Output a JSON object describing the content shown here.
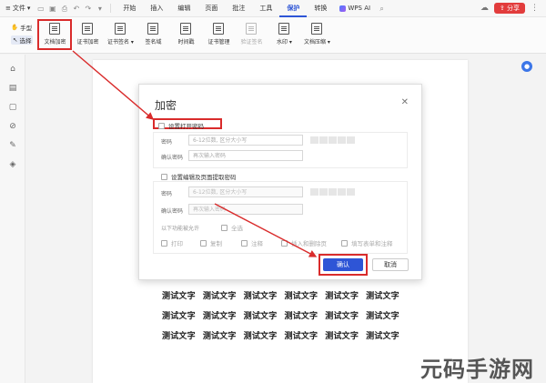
{
  "menubar": {
    "file_label": "文件",
    "tabs": [
      {
        "label": "开始"
      },
      {
        "label": "插入"
      },
      {
        "label": "编辑"
      },
      {
        "label": "页面"
      },
      {
        "label": "批注"
      },
      {
        "label": "工具"
      },
      {
        "label": "保护",
        "active": true
      },
      {
        "label": "转换"
      }
    ],
    "ai_label": "WPS AI",
    "share_label": "分享"
  },
  "ribbon": {
    "mode_items": [
      {
        "label": "手型",
        "icon": "hand-icon"
      },
      {
        "label": "选择",
        "icon": "cursor-icon",
        "selected": true
      }
    ],
    "buttons": [
      {
        "label": "文档加密",
        "highlighted": true
      },
      {
        "label": "证书加密"
      },
      {
        "label": "证书签名 ▾"
      },
      {
        "label": "签名域"
      },
      {
        "label": "时间戳"
      },
      {
        "label": "证书管理"
      },
      {
        "label": "验证签名",
        "disabled": true
      },
      {
        "label": "水印 ▾"
      },
      {
        "label": "文档压缩 ▾"
      }
    ]
  },
  "dialog": {
    "title": "加密",
    "open_password": {
      "checkbox_label": "设置打开密码",
      "password_label": "密码",
      "password_placeholder": "6-12位数, 区分大小写",
      "confirm_label": "确认密码",
      "confirm_placeholder": "再次输入密码"
    },
    "edit_password": {
      "checkbox_label": "设置编辑及页面提取密码",
      "password_label": "密码",
      "password_placeholder": "6-12位数, 区分大小写",
      "confirm_label": "确认密码",
      "confirm_placeholder": "再次输入密码"
    },
    "permissions_label": "以下功能被允许",
    "select_all_label": "全选",
    "permissions": [
      {
        "label": "打印"
      },
      {
        "label": "复制"
      },
      {
        "label": "注释"
      },
      {
        "label": "插入和删除页"
      },
      {
        "label": "填写表单和注释"
      }
    ],
    "ok_label": "确认",
    "cancel_label": "取消"
  },
  "document": {
    "rows": [
      [
        "测试文字",
        "测试文字",
        "测试文字",
        "测试文字",
        "测试文字",
        "测试文字"
      ],
      [
        "测试文字",
        "测试文字",
        "测试文字",
        "测试文字",
        "测试文字",
        "测试文字"
      ],
      [
        "测试文字",
        "测试文字",
        "测试文字",
        "测试文字",
        "测试文字",
        "测试文字"
      ]
    ]
  },
  "watermark": "元码手游网",
  "colors": {
    "accent": "#2e55d6",
    "highlight": "#d92b2b",
    "share": "#e23c3c"
  }
}
